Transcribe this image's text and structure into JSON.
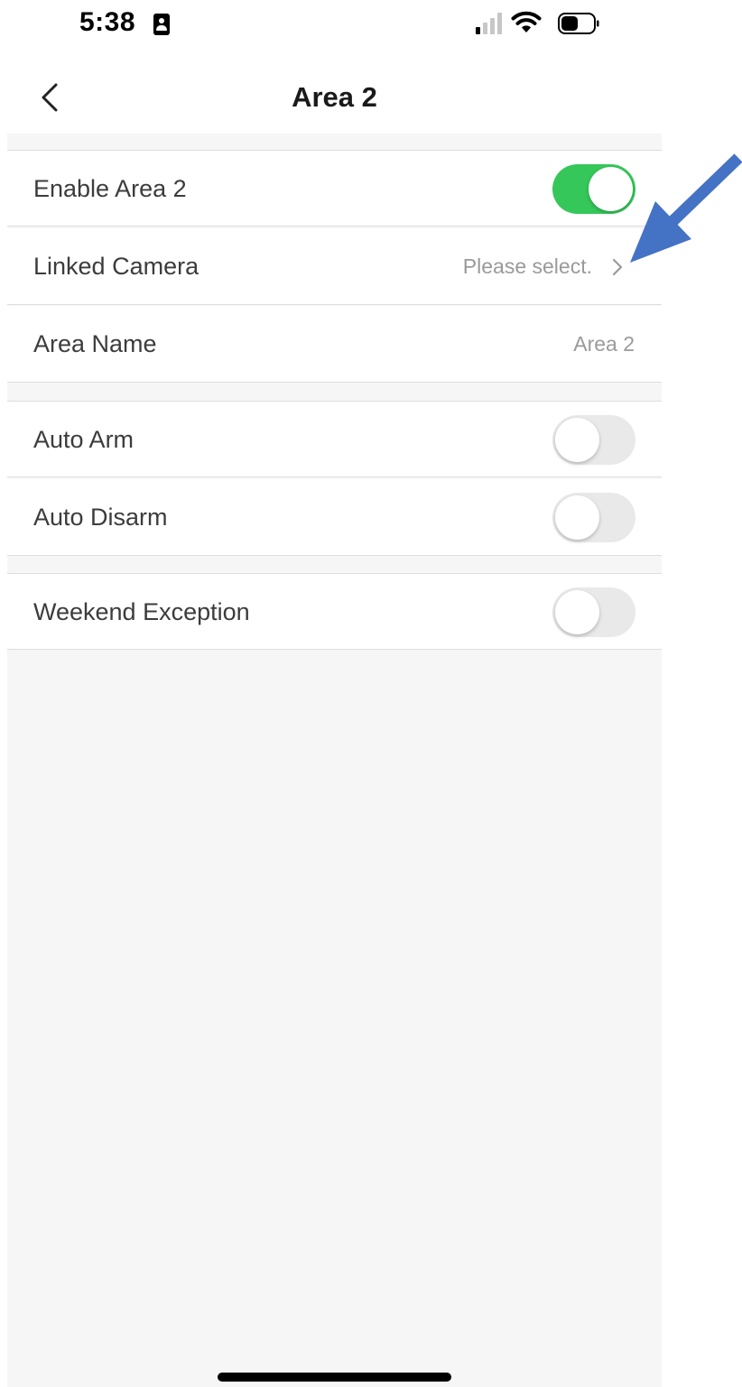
{
  "status_bar": {
    "time": "5:38",
    "signal_icon": "cellular-signal-icon",
    "wifi_icon": "wifi-icon",
    "battery_icon": "battery-icon"
  },
  "nav": {
    "back_icon": "chevron-left-icon",
    "title": "Area 2"
  },
  "rows": {
    "enable_area": {
      "label": "Enable Area 2",
      "toggle_on": true
    },
    "linked_camera": {
      "label": "Linked Camera",
      "value": "Please select."
    },
    "area_name": {
      "label": "Area Name",
      "value": "Area 2"
    },
    "auto_arm": {
      "label": "Auto Arm",
      "toggle_on": false
    },
    "auto_disarm": {
      "label": "Auto Disarm",
      "toggle_on": false
    },
    "weekend_exception": {
      "label": "Weekend Exception",
      "toggle_on": false
    }
  },
  "colors": {
    "toggle_on": "#35c75a",
    "toggle_off": "#e9e9ea",
    "annotation_arrow": "#4472c4"
  }
}
